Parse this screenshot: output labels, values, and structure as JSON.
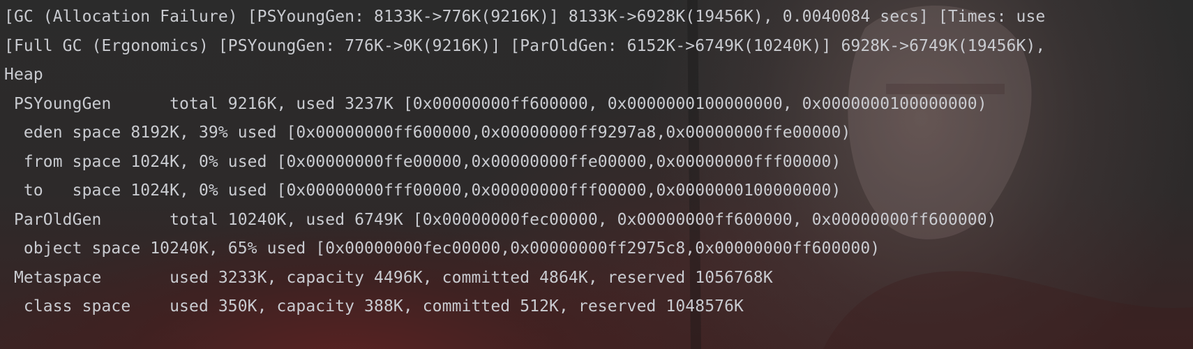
{
  "console": {
    "lines": [
      "[GC (Allocation Failure) [PSYoungGen: 8133K->776K(9216K)] 8133K->6928K(19456K), 0.0040084 secs] [Times: use",
      "[Full GC (Ergonomics) [PSYoungGen: 776K->0K(9216K)] [ParOldGen: 6152K->6749K(10240K)] 6928K->6749K(19456K),",
      "Heap",
      " PSYoungGen      total 9216K, used 3237K [0x00000000ff600000, 0x0000000100000000, 0x0000000100000000)",
      "  eden space 8192K, 39% used [0x00000000ff600000,0x00000000ff9297a8,0x00000000ffe00000)",
      "  from space 1024K, 0% used [0x00000000ffe00000,0x00000000ffe00000,0x00000000fff00000)",
      "  to   space 1024K, 0% used [0x00000000fff00000,0x00000000fff00000,0x0000000100000000)",
      " ParOldGen       total 10240K, used 6749K [0x00000000fec00000, 0x00000000ff600000, 0x00000000ff600000)",
      "  object space 10240K, 65% used [0x00000000fec00000,0x00000000ff2975c8,0x00000000ff600000)",
      " Metaspace       used 3233K, capacity 4496K, committed 4864K, reserved 1056768K",
      "  class space    used 350K, capacity 388K, committed 512K, reserved 1048576K"
    ]
  },
  "colors": {
    "text": "#c9cbd0",
    "background": "#2b2b2b"
  }
}
